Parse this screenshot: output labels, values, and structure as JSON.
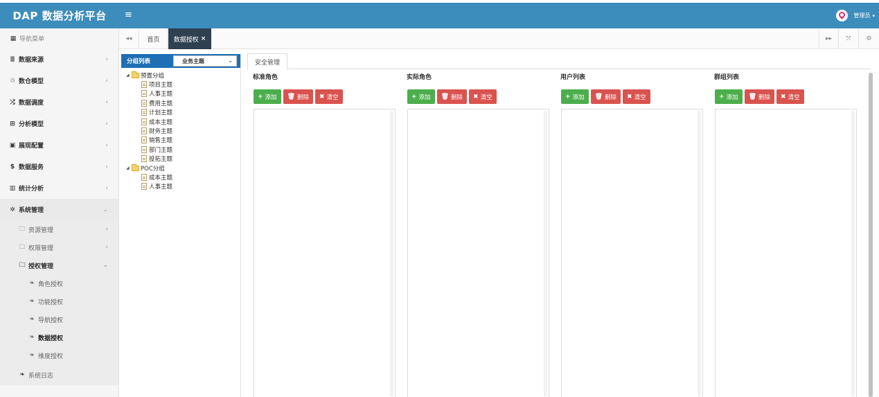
{
  "header": {
    "brand": "DAP 数据分析平台",
    "menu_toggle": "≡",
    "user_name": "管理员",
    "user_caret": "▾",
    "accent_color": "#3c8dbc"
  },
  "sidebar": {
    "nav_header": "导航菜单",
    "items": [
      {
        "icon": "database-icon",
        "glyph": "≣",
        "label": "数据来源",
        "caret": "‹"
      },
      {
        "icon": "cubes-icon",
        "glyph": "♲",
        "label": "数仓模型",
        "caret": "‹"
      },
      {
        "icon": "random-icon",
        "glyph": "⤮",
        "label": "数据调度",
        "caret": "‹"
      },
      {
        "icon": "sitemap-icon",
        "glyph": "⊞",
        "label": "分析模型",
        "caret": "‹"
      },
      {
        "icon": "film-icon",
        "glyph": "▣",
        "label": "展现配置",
        "caret": "‹"
      },
      {
        "icon": "money-icon",
        "glyph": "$",
        "label": "数据服务",
        "caret": "‹"
      },
      {
        "icon": "bar-chart-icon",
        "glyph": "▥",
        "label": "统计分析",
        "caret": "‹"
      },
      {
        "icon": "gear-icon",
        "glyph": "✲",
        "label": "系统管理",
        "caret": "⌄"
      }
    ],
    "sub_items": [
      {
        "label": "资源管理",
        "caret": "‹"
      },
      {
        "label": "权限管理",
        "caret": "‹"
      },
      {
        "label": "授权管理",
        "caret": "⌄"
      }
    ],
    "leaves": [
      "角色授权",
      "功能授权",
      "导航授权",
      "数据授权",
      "维度授权"
    ],
    "syslog": "系统日志"
  },
  "tabbar": {
    "back": "◂◂",
    "home": "首页",
    "current": "数据授权",
    "close": "×",
    "forward": "▸▸",
    "fullscreen": "⤧",
    "settings": "⚙"
  },
  "group_panel": {
    "title": "分组列表",
    "selected_theme": "业务主题",
    "tree": [
      {
        "label": "预置分组",
        "children": [
          "项目主题",
          "人事主题",
          "费用主题",
          "计划主题",
          "成本主题",
          "财务主题",
          "销售主题",
          "部门主题",
          "投拓主题"
        ]
      },
      {
        "label": "POC分组",
        "children": [
          "成本主题",
          "人事主题"
        ]
      }
    ]
  },
  "content": {
    "tab": "安全管理",
    "columns": [
      {
        "title": "标准角色"
      },
      {
        "title": "实际角色"
      },
      {
        "title": "用户列表"
      },
      {
        "title": "群组列表"
      }
    ],
    "buttons": {
      "add": "添加",
      "delete": "删除",
      "clear": "清空",
      "add_icon": "+",
      "delete_icon": "🗑",
      "clear_icon": "✖"
    }
  }
}
